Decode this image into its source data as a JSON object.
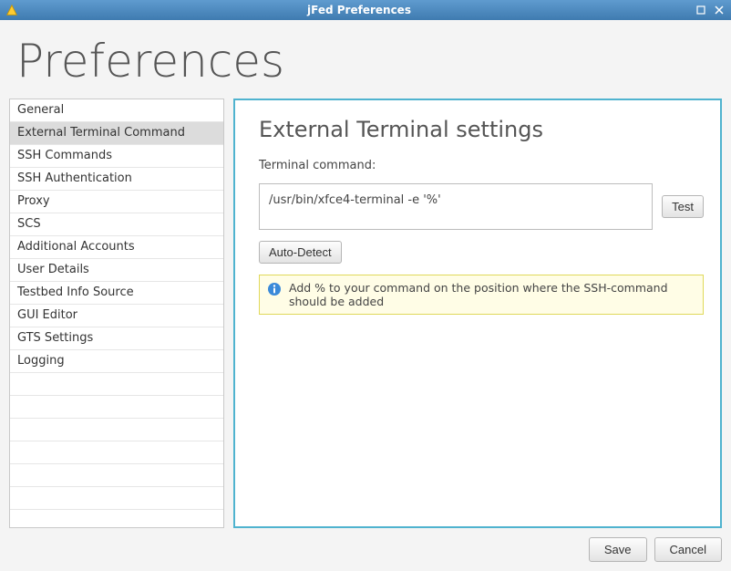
{
  "window": {
    "title": "jFed Preferences"
  },
  "page": {
    "heading": "Preferences"
  },
  "sidebar": {
    "items": [
      {
        "label": "General"
      },
      {
        "label": "External Terminal Command",
        "selected": true
      },
      {
        "label": "SSH Commands"
      },
      {
        "label": "SSH Authentication"
      },
      {
        "label": "Proxy"
      },
      {
        "label": "SCS"
      },
      {
        "label": "Additional Accounts"
      },
      {
        "label": "User Details"
      },
      {
        "label": "Testbed Info Source"
      },
      {
        "label": "GUI Editor"
      },
      {
        "label": "GTS Settings"
      },
      {
        "label": "Logging"
      }
    ]
  },
  "content": {
    "section_title": "External Terminal settings",
    "terminal_command_label": "Terminal command:",
    "terminal_command_value": "/usr/bin/xfce4-terminal -e '%'",
    "test_button_label": "Test",
    "auto_detect_label": "Auto-Detect",
    "info_text": "Add % to your command on the position where the SSH-command should be added"
  },
  "footer": {
    "save_label": "Save",
    "cancel_label": "Cancel"
  }
}
